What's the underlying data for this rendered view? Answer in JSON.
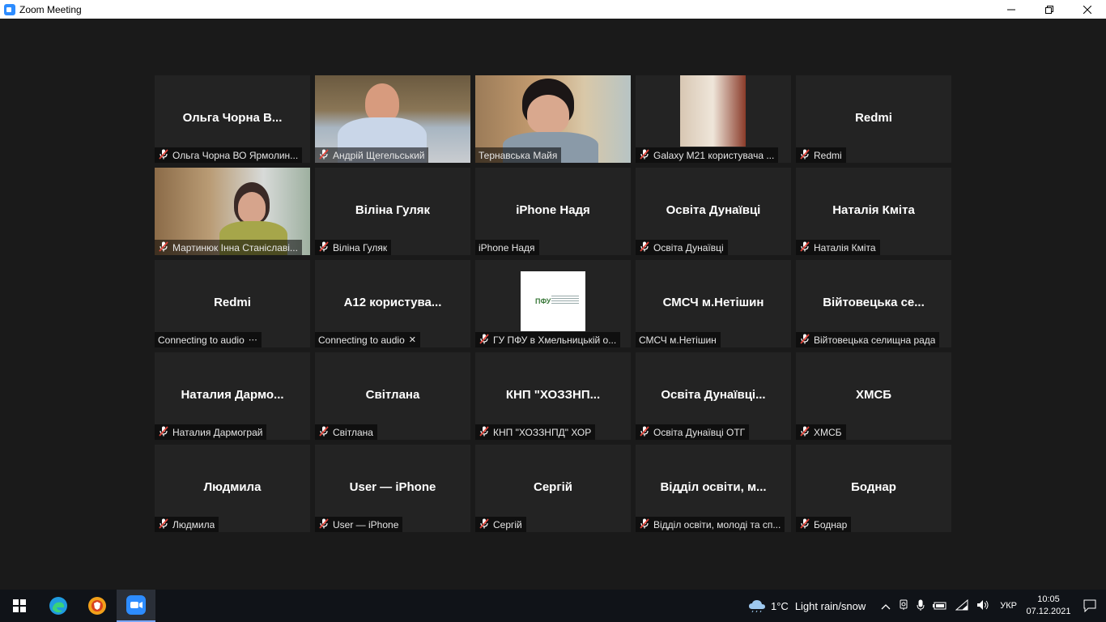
{
  "window": {
    "title": "Zoom Meeting"
  },
  "participants": [
    {
      "name": "Ольга Чорна В...",
      "label": "Ольга Чорна ВО Ярмолин...",
      "muted": true
    },
    {
      "name": "",
      "label": "Андрій Щегельський",
      "muted": true,
      "video": true
    },
    {
      "name": "",
      "label": "Тернавська Майя",
      "muted": false,
      "video": true,
      "speaker": true
    },
    {
      "name": "",
      "label": "Galaxy M21 користувача ...",
      "muted": true,
      "video": true
    },
    {
      "name": "Redmi",
      "label": "Redmi",
      "muted": true
    },
    {
      "name": "",
      "label": "Мартинюк Інна Станіславі...",
      "muted": true,
      "video": true
    },
    {
      "name": "Віліна Гуляк",
      "label": "Віліна Гуляк",
      "muted": true
    },
    {
      "name": "iPhone Надя",
      "label": "iPhone Надя",
      "muted": false
    },
    {
      "name": "Освіта Дунаївці",
      "label": "Освіта Дунаївці",
      "muted": true
    },
    {
      "name": "Наталія Кміта",
      "label": "Наталія Кміта",
      "muted": true
    },
    {
      "name": "Redmi",
      "label": "Connecting to audio",
      "muted": false,
      "connecting": "⋯"
    },
    {
      "name": "А12  користува...",
      "label": "Connecting to audio",
      "muted": false,
      "connecting": "✕"
    },
    {
      "name": "",
      "label": "ГУ ПФУ в Хмельницькій о...",
      "muted": true,
      "video": true,
      "logo_text": "ПФУ"
    },
    {
      "name": "СМСЧ м.Нетішин",
      "label": "СМСЧ м.Нетішин",
      "muted": false
    },
    {
      "name": "Війтовецька  се...",
      "label": "Війтовецька селищна рада",
      "muted": true
    },
    {
      "name": "Наталия  Дармо...",
      "label": "Наталия Дармограй",
      "muted": true
    },
    {
      "name": "Світлана",
      "label": "Світлана",
      "muted": true
    },
    {
      "name": "КНП  \"ХОЗЗНП...",
      "label": "КНП \"ХОЗЗНПД\" ХОР",
      "muted": true
    },
    {
      "name": "Освіта Дунаївці...",
      "label": "Освіта Дунаївці ОТГ",
      "muted": true
    },
    {
      "name": "ХМСБ",
      "label": "ХМСБ",
      "muted": true
    },
    {
      "name": "Людмила",
      "label": "Людмила",
      "muted": true
    },
    {
      "name": "User — iPhone",
      "label": "User — iPhone",
      "muted": true
    },
    {
      "name": "Сергій",
      "label": "Сергій",
      "muted": true
    },
    {
      "name": "Відділ освіти, м...",
      "label": "Відділ освіти, молоді та сп...",
      "muted": true
    },
    {
      "name": "Боднар",
      "label": "Боднар",
      "muted": true
    }
  ],
  "taskbar": {
    "weather_temp": "1°C",
    "weather_desc": "Light rain/snow",
    "language": "УКР",
    "time": "10:05",
    "date": "07.12.2021"
  },
  "colors": {
    "speaker_border": "#c3d84a",
    "muted_icon": "#e0463c",
    "accent": "#2d8cff"
  }
}
